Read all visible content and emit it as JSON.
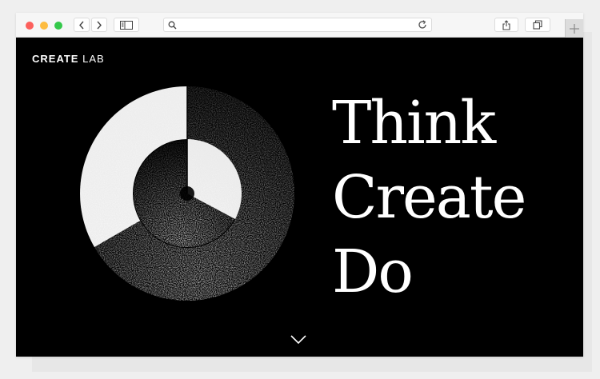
{
  "browser": {
    "icons": {
      "back": "chevron-left-icon",
      "forward": "chevron-right-icon",
      "sidebar": "sidebar-icon",
      "search": "search-icon",
      "reload": "reload-icon",
      "share": "share-icon",
      "tabs": "tabs-icon",
      "new_tab": "plus-icon"
    },
    "address_value": "",
    "colors": {
      "close": "#fc605c",
      "minimize": "#fdbc40",
      "zoom": "#34c84a"
    }
  },
  "site": {
    "logo_bold": "CREATE",
    "logo_light": "LAB",
    "headline": [
      "Think",
      "Create",
      "Do"
    ],
    "scroll_icon": "chevron-down-icon",
    "colors": {
      "background": "#000000",
      "foreground": "#ffffff"
    }
  }
}
